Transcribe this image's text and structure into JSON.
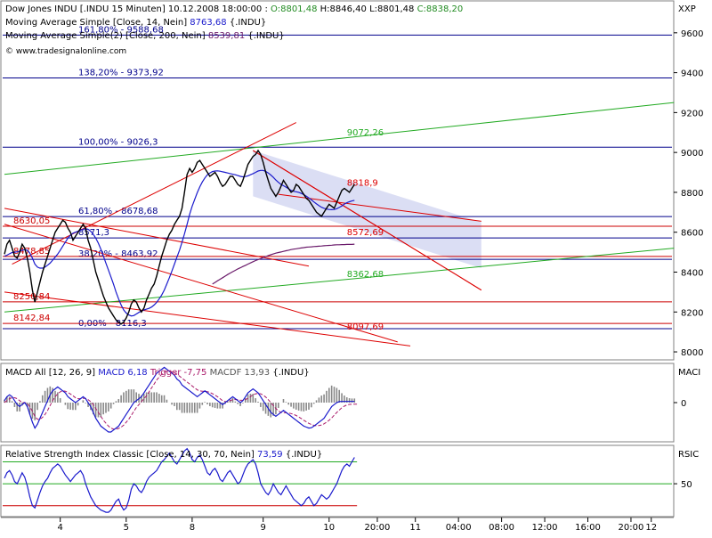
{
  "header": {
    "title": "Dow Jones INDU [.INDU  15 Minuten] 10.12.2008 18:00:00 :",
    "o": "O:8801,48",
    "h": "H:8846,40",
    "l": "L:8801,48",
    "c": "C:8838,20",
    "ma1_label": "Moving Average Simple [Close, 14, Nein]",
    "ma1_value": "8763,68",
    "ma1_suffix": "{.INDU}",
    "ma2_label": "Moving Average Simple(2) [Close, 200, Nein]",
    "ma2_value": "8539,81",
    "ma2_suffix": "{.INDU}",
    "copyright": "© www.tradesignalonline.com",
    "axis_unit_price": "XXP"
  },
  "macd_header": {
    "label": "MACD All [12, 26, 9]",
    "macd": "MACD 6,18",
    "trigger": "Trigger -7,75",
    "macdf": "MACDF 13,93",
    "suffix": "{.INDU}",
    "axis_unit": "MACI"
  },
  "rsi_header": {
    "label": "Relative Strength Index Classic [Close, 14, 30, 70, Nein]",
    "value": "73,59",
    "suffix": "{.INDU}",
    "axis_unit": "RSIC"
  },
  "colors": {
    "fib": "#00008b",
    "level_red": "#cc0000",
    "trend_red": "#dd0000",
    "trend_green": "#22aa22",
    "ma": "#1a1acc",
    "ma200": "#6a1a6a",
    "channel_fill": "#cfd3f0",
    "price": "#000000",
    "macd_line": "#1a1acc",
    "trigger_line": "#aa1a6a"
  },
  "chart_data": [
    {
      "type": "line",
      "panel": "price",
      "ylim": [
        7960,
        9760
      ],
      "y_ticks": [
        8000,
        8200,
        8400,
        8600,
        8800,
        9000,
        9200,
        9400,
        9600
      ],
      "y_tick_labels": [
        "8000",
        "8200",
        "8400",
        "8600",
        "8800",
        "9000",
        "9200",
        "9400",
        "9600"
      ],
      "x_ticks": [
        {
          "label": "4",
          "bar": 22
        },
        {
          "label": "5",
          "bar": 48
        },
        {
          "label": "8",
          "bar": 74
        },
        {
          "label": "9",
          "bar": 102
        },
        {
          "label": "10",
          "bar": 128
        },
        {
          "label": "20:00",
          "bar": 147
        },
        {
          "label": "11",
          "bar": 162
        },
        {
          "label": "04:00",
          "bar": 179
        },
        {
          "label": "08:00",
          "bar": 196
        },
        {
          "label": "12:00",
          "bar": 213
        },
        {
          "label": "16:00",
          "bar": 230
        },
        {
          "label": "20:00",
          "bar": 247
        },
        {
          "label": "12",
          "bar": 255
        }
      ],
      "fib_levels": [
        {
          "label": "161,80% - 9588,68",
          "value": 9588.68
        },
        {
          "label": "138,20% - 9373,92",
          "value": 9373.92
        },
        {
          "label": "100,00% - 9026,3",
          "value": 9026.3
        },
        {
          "label": "61,80% - 8678,68",
          "value": 8678.68
        },
        {
          "label": "8571,3",
          "value": 8571.3
        },
        {
          "label": "38,20% - 8463,92",
          "value": 8463.92
        },
        {
          "label": "0,00% - 8116,3",
          "value": 8116.3
        }
      ],
      "red_levels": [
        {
          "label": "8630,05",
          "value": 8630.05
        },
        {
          "label": "8478,85",
          "value": 8478.85
        },
        {
          "label": "8250,84",
          "value": 8250.84
        },
        {
          "label": "8142,84",
          "value": 8142.84
        }
      ],
      "trend_labels": [
        {
          "label": "9072,26",
          "value": 9072.26,
          "bar": 135,
          "color": "trend_green"
        },
        {
          "label": "8818,9",
          "value": 8818.9,
          "bar": 135,
          "color": "trend_red"
        },
        {
          "label": "8572,69",
          "value": 8572.69,
          "bar": 135,
          "color": "trend_red"
        },
        {
          "label": "8362,68",
          "value": 8362.68,
          "bar": 135,
          "color": "trend_green"
        },
        {
          "label": "8097,69",
          "value": 8097.69,
          "bar": 135,
          "color": "trend_red"
        }
      ],
      "trend_lines": [
        {
          "color": "trend_green",
          "from": [
            0,
            8890
          ],
          "to": [
            264,
            9250
          ]
        },
        {
          "color": "trend_green",
          "from": [
            0,
            8200
          ],
          "to": [
            264,
            8520
          ]
        },
        {
          "color": "trend_red",
          "from": [
            3,
            8440
          ],
          "to": [
            115,
            9150
          ]
        },
        {
          "color": "trend_red",
          "from": [
            0,
            8720
          ],
          "to": [
            120,
            8430
          ]
        },
        {
          "color": "trend_red",
          "from": [
            0,
            8640
          ],
          "to": [
            155,
            8050
          ]
        },
        {
          "color": "trend_red",
          "from": [
            0,
            8300
          ],
          "to": [
            160,
            8030
          ]
        },
        {
          "color": "trend_red",
          "from": [
            98,
            9010
          ],
          "to": [
            188,
            8310
          ]
        },
        {
          "color": "trend_red",
          "from": [
            98,
            9010
          ],
          "to": [
            188,
            8310
          ]
        },
        {
          "color": "trend_red",
          "from": [
            108,
            8790
          ],
          "to": [
            188,
            8655
          ]
        }
      ],
      "channel": [
        [
          98,
          9010
        ],
        [
          188,
          8650
        ],
        [
          188,
          8420
        ],
        [
          98,
          8780
        ]
      ],
      "close": [
        8490,
        8540,
        8560,
        8520,
        8480,
        8470,
        8500,
        8540,
        8520,
        8470,
        8400,
        8310,
        8250,
        8300,
        8350,
        8400,
        8440,
        8480,
        8520,
        8560,
        8600,
        8620,
        8640,
        8660,
        8650,
        8620,
        8600,
        8560,
        8580,
        8600,
        8620,
        8640,
        8620,
        8560,
        8520,
        8460,
        8400,
        8360,
        8320,
        8280,
        8250,
        8220,
        8200,
        8180,
        8160,
        8150,
        8140,
        8150,
        8170,
        8200,
        8240,
        8260,
        8250,
        8220,
        8200,
        8220,
        8260,
        8290,
        8320,
        8340,
        8380,
        8430,
        8480,
        8520,
        8560,
        8590,
        8610,
        8640,
        8660,
        8680,
        8720,
        8800,
        8890,
        8920,
        8900,
        8920,
        8950,
        8960,
        8940,
        8920,
        8900,
        8880,
        8890,
        8900,
        8880,
        8850,
        8830,
        8840,
        8860,
        8880,
        8880,
        8860,
        8840,
        8830,
        8860,
        8900,
        8940,
        8960,
        8980,
        8990,
        9010,
        8990,
        8950,
        8900,
        8860,
        8820,
        8800,
        8780,
        8800,
        8830,
        8860,
        8840,
        8820,
        8800,
        8810,
        8840,
        8830,
        8810,
        8790,
        8770,
        8760,
        8740,
        8720,
        8700,
        8690,
        8680,
        8700,
        8720,
        8740,
        8730,
        8720,
        8750,
        8780,
        8810,
        8820,
        8810,
        8800,
        8820,
        8840
      ],
      "ma14": [
        8480,
        8485,
        8492,
        8498,
        8500,
        8502,
        8505,
        8510,
        8512,
        8510,
        8495,
        8470,
        8440,
        8425,
        8420,
        8420,
        8425,
        8435,
        8445,
        8460,
        8475,
        8490,
        8510,
        8530,
        8550,
        8570,
        8585,
        8595,
        8600,
        8605,
        8610,
        8615,
        8618,
        8615,
        8605,
        8590,
        8570,
        8545,
        8515,
        8480,
        8445,
        8410,
        8375,
        8340,
        8300,
        8265,
        8235,
        8210,
        8195,
        8185,
        8180,
        8182,
        8190,
        8198,
        8205,
        8210,
        8214,
        8218,
        8225,
        8235,
        8248,
        8265,
        8285,
        8310,
        8340,
        8372,
        8405,
        8440,
        8475,
        8510,
        8550,
        8592,
        8640,
        8690,
        8730,
        8765,
        8798,
        8828,
        8852,
        8872,
        8888,
        8897,
        8904,
        8907,
        8908,
        8906,
        8903,
        8900,
        8897,
        8894,
        8891,
        8888,
        8884,
        8880,
        8878,
        8879,
        8883,
        8888,
        8894,
        8900,
        8907,
        8910,
        8910,
        8905,
        8897,
        8887,
        8875,
        8862,
        8850,
        8840,
        8833,
        8826,
        8818,
        8810,
        8805,
        8803,
        8800,
        8795,
        8789,
        8781,
        8772,
        8762,
        8752,
        8742,
        8733,
        8725,
        8720,
        8716,
        8714,
        8713,
        8714,
        8718,
        8724,
        8732,
        8741,
        8748,
        8753,
        8757,
        8760
      ],
      "ma200": [
        null,
        null,
        null,
        null,
        null,
        null,
        null,
        null,
        null,
        null,
        null,
        null,
        null,
        null,
        null,
        null,
        null,
        null,
        null,
        null,
        null,
        null,
        null,
        null,
        null,
        null,
        null,
        null,
        null,
        null,
        null,
        null,
        null,
        null,
        null,
        null,
        null,
        null,
        null,
        null,
        null,
        null,
        null,
        null,
        null,
        null,
        null,
        null,
        null,
        null,
        null,
        null,
        null,
        null,
        null,
        null,
        null,
        null,
        null,
        null,
        null,
        null,
        null,
        null,
        null,
        null,
        null,
        null,
        null,
        null,
        null,
        null,
        null,
        null,
        null,
        null,
        null,
        null,
        null,
        null,
        null,
        null,
        8340,
        8348,
        8356,
        8364,
        8372,
        8380,
        8388,
        8395,
        8402,
        8409,
        8416,
        8422,
        8428,
        8434,
        8440,
        8446,
        8452,
        8458,
        8463,
        8468,
        8473,
        8478,
        8483,
        8487,
        8491,
        8495,
        8498,
        8501,
        8504,
        8507,
        8510,
        8513,
        8515,
        8517,
        8519,
        8521,
        8523,
        8525,
        8526,
        8527,
        8528,
        8529,
        8530,
        8531,
        8532,
        8533,
        8534,
        8535,
        8536,
        8537,
        8537,
        8538,
        8538,
        8539,
        8539,
        8539,
        8540
      ],
      "ma200_start": 82
    },
    {
      "type": "line",
      "panel": "macd",
      "ylim": [
        -200,
        200
      ],
      "y_ticks": [
        0
      ],
      "y_tick_labels": [
        "0"
      ],
      "macd": [
        10,
        30,
        40,
        30,
        10,
        -10,
        -20,
        -10,
        0,
        -20,
        -60,
        -100,
        -130,
        -110,
        -80,
        -50,
        -20,
        10,
        40,
        60,
        70,
        80,
        70,
        60,
        50,
        30,
        20,
        10,
        0,
        10,
        20,
        30,
        20,
        0,
        -20,
        -50,
        -80,
        -100,
        -120,
        -130,
        -140,
        -150,
        -150,
        -140,
        -130,
        -120,
        -100,
        -80,
        -60,
        -40,
        -20,
        0,
        10,
        20,
        30,
        50,
        70,
        90,
        110,
        130,
        150,
        160,
        170,
        180,
        170,
        160,
        150,
        140,
        120,
        110,
        90,
        80,
        70,
        60,
        50,
        40,
        30,
        40,
        50,
        60,
        50,
        40,
        30,
        20,
        10,
        0,
        -10,
        0,
        10,
        20,
        30,
        20,
        10,
        0,
        10,
        30,
        50,
        60,
        70,
        60,
        50,
        30,
        10,
        -10,
        -30,
        -50,
        -60,
        -70,
        -60,
        -50,
        -40,
        -50,
        -60,
        -70,
        -80,
        -90,
        -100,
        -110,
        -120,
        -125,
        -130,
        -128,
        -120,
        -110,
        -100,
        -90,
        -80,
        -60,
        -40,
        -20,
        -10,
        0,
        5,
        6,
        6,
        6,
        6,
        6,
        6
      ],
      "trigger": [
        0,
        10,
        20,
        25,
        25,
        20,
        10,
        0,
        0,
        -5,
        -20,
        -45,
        -70,
        -85,
        -85,
        -75,
        -60,
        -40,
        -15,
        10,
        30,
        45,
        55,
        60,
        58,
        52,
        44,
        35,
        25,
        20,
        20,
        22,
        22,
        15,
        5,
        -10,
        -30,
        -50,
        -70,
        -90,
        -105,
        -120,
        -130,
        -135,
        -135,
        -132,
        -125,
        -115,
        -100,
        -85,
        -65,
        -45,
        -25,
        -10,
        5,
        20,
        35,
        55,
        75,
        95,
        115,
        130,
        145,
        155,
        160,
        160,
        157,
        152,
        145,
        135,
        125,
        115,
        105,
        95,
        85,
        75,
        65,
        60,
        58,
        58,
        56,
        52,
        46,
        38,
        30,
        20,
        10,
        5,
        5,
        10,
        15,
        16,
        15,
        12,
        12,
        15,
        22,
        30,
        40,
        45,
        47,
        45,
        38,
        28,
        15,
        0,
        -15,
        -30,
        -42,
        -50,
        -52,
        -52,
        -53,
        -56,
        -60,
        -66,
        -73,
        -81,
        -90,
        -98,
        -106,
        -112,
        -116,
        -118,
        -117,
        -114,
        -108,
        -100,
        -90,
        -78,
        -64,
        -50,
        -38,
        -26,
        -18,
        -12,
        -9,
        -8,
        -8,
        -8
      ]
    },
    {
      "type": "line",
      "panel": "rsi",
      "ylim": [
        20,
        85
      ],
      "y_ticks": [
        50
      ],
      "y_tick_labels": [
        "50"
      ],
      "levels": [
        70,
        30
      ],
      "rsi": [
        55,
        60,
        62,
        58,
        52,
        50,
        55,
        60,
        56,
        48,
        38,
        30,
        28,
        35,
        42,
        48,
        52,
        55,
        60,
        64,
        66,
        68,
        66,
        62,
        58,
        55,
        52,
        55,
        58,
        60,
        62,
        58,
        50,
        44,
        38,
        34,
        30,
        28,
        26,
        25,
        24,
        24,
        26,
        30,
        34,
        36,
        30,
        26,
        28,
        35,
        45,
        50,
        48,
        44,
        42,
        46,
        52,
        56,
        58,
        60,
        62,
        66,
        70,
        72,
        75,
        78,
        74,
        70,
        68,
        72,
        76,
        80,
        82,
        78,
        72,
        70,
        74,
        76,
        72,
        66,
        60,
        58,
        62,
        64,
        60,
        54,
        52,
        56,
        60,
        62,
        58,
        54,
        50,
        52,
        58,
        64,
        68,
        70,
        72,
        68,
        60,
        50,
        46,
        42,
        40,
        44,
        50,
        46,
        42,
        40,
        44,
        48,
        44,
        40,
        36,
        34,
        32,
        30,
        32,
        36,
        38,
        34,
        30,
        32,
        36,
        40,
        38,
        36,
        38,
        42,
        46,
        50,
        56,
        62,
        66,
        68,
        66,
        70,
        74
      ]
    }
  ]
}
